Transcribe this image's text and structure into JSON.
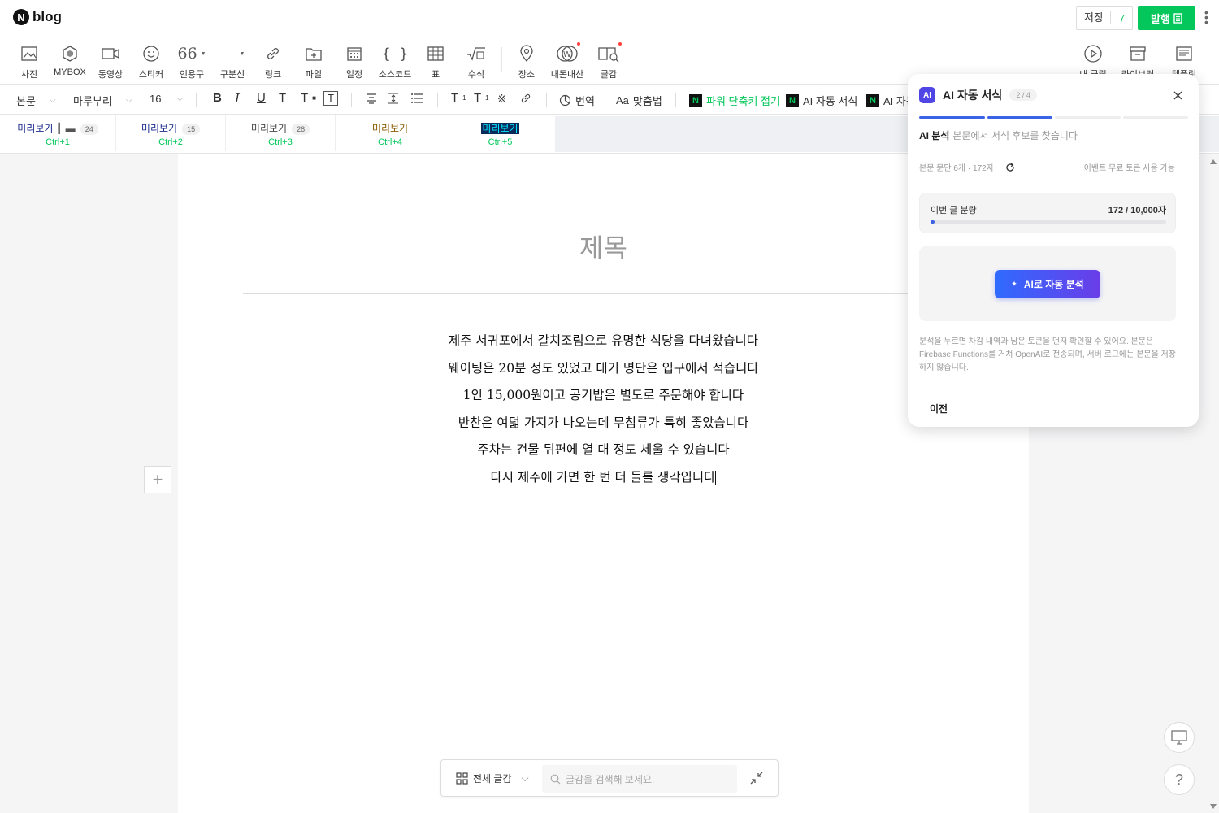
{
  "app": {
    "logo_text": "blog"
  },
  "header": {
    "save_label": "저장",
    "save_count": "7",
    "publish_label": "발행"
  },
  "toolbar": {
    "items": [
      {
        "label": "사진",
        "icon": "image-icon"
      },
      {
        "label": "MYBOX",
        "icon": "mybox-icon"
      },
      {
        "label": "동영상",
        "icon": "video-icon"
      },
      {
        "label": "스티커",
        "icon": "sticker-icon"
      },
      {
        "label": "인용구",
        "icon": "quote-icon"
      },
      {
        "label": "구분선",
        "icon": "divider-icon"
      },
      {
        "label": "링크",
        "icon": "link-icon"
      },
      {
        "label": "파일",
        "icon": "file-icon"
      },
      {
        "label": "일정",
        "icon": "calendar-icon"
      },
      {
        "label": "소스코드",
        "icon": "code-icon"
      },
      {
        "label": "표",
        "icon": "table-icon"
      },
      {
        "label": "수식",
        "icon": "formula-icon"
      },
      {
        "label": "장소",
        "icon": "place-icon"
      },
      {
        "label": "내돈내산",
        "icon": "mymoney-icon"
      },
      {
        "label": "글감",
        "icon": "material-icon"
      },
      {
        "label": "내 클립",
        "icon": "clip-icon"
      },
      {
        "label": "라이브러리",
        "icon": "library-icon"
      },
      {
        "label": "템플릿",
        "icon": "template-icon"
      }
    ]
  },
  "format_bar": {
    "paragraph": "본문",
    "font": "마루부리",
    "size": "16",
    "translate": "번역",
    "spell": "맞춤법",
    "power_shortcut": "파워 단축키 접기",
    "ai_format": "AI 자동 서식",
    "ai_format_truncated": "AI 자동"
  },
  "presets": [
    {
      "label": "미리보기",
      "count": "24",
      "shortcut": "Ctrl+1"
    },
    {
      "label": "미리보기",
      "count": "15",
      "shortcut": "Ctrl+2"
    },
    {
      "label": "미리보기",
      "count": "28",
      "shortcut": "Ctrl+3"
    },
    {
      "label": "미리보기",
      "count": "",
      "shortcut": "Ctrl+4"
    },
    {
      "label": "미리보기",
      "count": "",
      "shortcut": "Ctrl+5"
    }
  ],
  "document": {
    "title_placeholder": "제목",
    "lines": [
      "제주 서귀포에서 갈치조림으로 유명한 식당을 다녀왔습니다",
      "웨이팅은 20분 정도 있었고 대기 명단은 입구에서 적습니다",
      "1인 15,000원이고 공기밥은 별도로 주문해야 합니다",
      "반찬은 여덟 가지가 나오는데 무침류가 특히 좋았습니다",
      "주차는 건물 뒤편에 열 대 정도 세울 수 있습니다",
      "다시 제주에 가면 한 번 더 들를 생각입니다"
    ]
  },
  "bottom_search": {
    "category": "전체 글감",
    "placeholder": "글감을 검색해 보세요."
  },
  "ai_panel": {
    "badge": "AI",
    "title": "AI 자동 서식",
    "step": "2 / 4",
    "progress_steps_done": 2,
    "progress_steps_total": 4,
    "section_title": "AI 분석",
    "section_desc": "본문에서 서식 후보를 찾습니다",
    "meta_left": "본문 문단 6개 · 172자",
    "meta_right": "이벤트 무료 토큰 사용 가능",
    "usage_label": "이번 글 분량",
    "usage_value": "172 / 10,000자",
    "usage_fraction": 0.0172,
    "cta_label": "AI로 자동 분석",
    "note": "분석을 누르면 차감 내역과 남은 토큰을 먼저 확인할 수 있어요. 본문은 Firebase Functions를 거쳐 OpenAI로 전송되며, 서버 로그에는 본문을 저장하지 않습니다.",
    "prev_label": "이전"
  },
  "colors": {
    "brand_green": "#03c75a",
    "ai_blue": "#3b63e6",
    "ai_badge": "#4f46e5"
  }
}
